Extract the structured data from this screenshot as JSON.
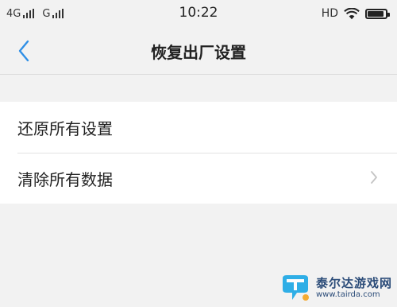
{
  "status_bar": {
    "network_1": "4G",
    "network_2": "G",
    "time": "10:22",
    "hd": "HD",
    "icons": [
      "signal-icon",
      "wifi-icon",
      "battery-icon"
    ],
    "battery_level": 0.9
  },
  "nav": {
    "back_icon": "chevron-left-icon",
    "title": "恢复出厂设置"
  },
  "settings": {
    "items": [
      {
        "label": "还原所有设置"
      },
      {
        "label": "清除所有数据",
        "icon": "chevron-right-icon"
      }
    ]
  },
  "watermark": {
    "name": "泰尔达游戏网",
    "url": "www.tairda.com"
  },
  "colors": {
    "accent": "#2f8fe6",
    "background": "#f2f2f2",
    "list_background": "#ffffff",
    "chevron": "#c4c4c4",
    "watermark_blue": "#1a3d6e"
  }
}
